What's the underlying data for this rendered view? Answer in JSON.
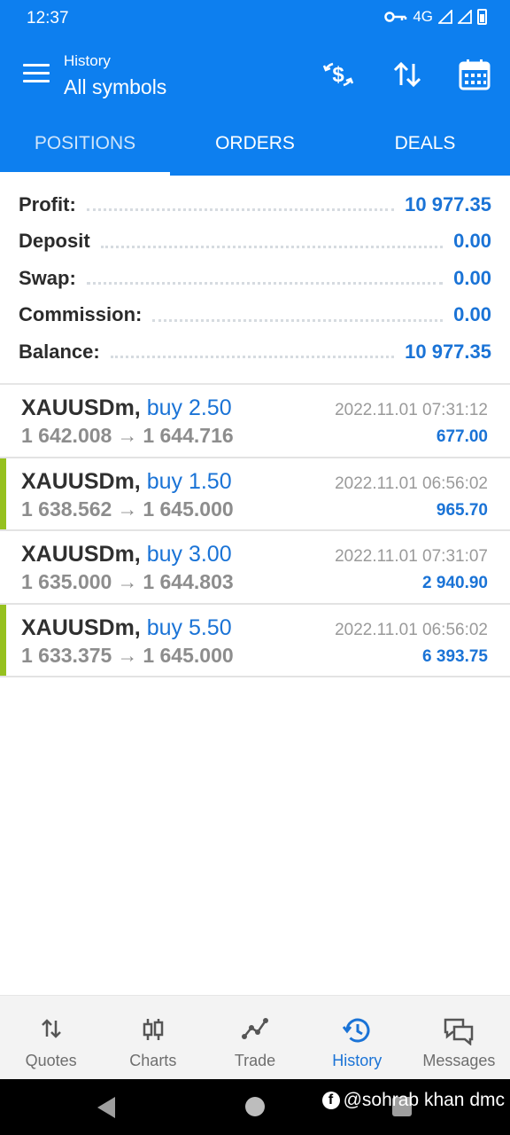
{
  "status_bar": {
    "time": "12:37",
    "network": "4G"
  },
  "app_bar": {
    "subtitle": "History",
    "title": "All symbols"
  },
  "tabs": [
    {
      "label": "POSITIONS",
      "active": true
    },
    {
      "label": "ORDERS",
      "active": false
    },
    {
      "label": "DEALS",
      "active": false
    }
  ],
  "summary": [
    {
      "label": "Profit:",
      "value": "10 977.35"
    },
    {
      "label": "Deposit",
      "value": "0.00"
    },
    {
      "label": "Swap:",
      "value": "0.00"
    },
    {
      "label": "Commission:",
      "value": "0.00"
    },
    {
      "label": "Balance:",
      "value": "10 977.35"
    }
  ],
  "deals": [
    {
      "symbol": "XAUUSDm,",
      "direction": "buy 2.50",
      "open_price": "1 642.008",
      "close_price": "1 644.716",
      "arrow": "→",
      "time": "2022.11.01 07:31:12",
      "profit": "677.00",
      "marked": false
    },
    {
      "symbol": "XAUUSDm,",
      "direction": "buy 1.50",
      "open_price": "1 638.562",
      "close_price": "1 645.000",
      "arrow": "→",
      "time": "2022.11.01 06:56:02",
      "profit": "965.70",
      "marked": true
    },
    {
      "symbol": "XAUUSDm,",
      "direction": "buy 3.00",
      "open_price": "1 635.000",
      "close_price": "1 644.803",
      "arrow": "→",
      "time": "2022.11.01 07:31:07",
      "profit": "2 940.90",
      "marked": false
    },
    {
      "symbol": "XAUUSDm,",
      "direction": "buy 5.50",
      "open_price": "1 633.375",
      "close_price": "1 645.000",
      "arrow": "→",
      "time": "2022.11.01 06:56:02",
      "profit": "6 393.75",
      "marked": true
    }
  ],
  "bottom_nav": [
    {
      "label": "Quotes",
      "icon": "quotes-arrows-icon",
      "active": false
    },
    {
      "label": "Charts",
      "icon": "candlestick-icon",
      "active": false
    },
    {
      "label": "Trade",
      "icon": "trade-line-icon",
      "active": false
    },
    {
      "label": "History",
      "icon": "history-clock-icon",
      "active": true
    },
    {
      "label": "Messages",
      "icon": "messages-icon",
      "active": false
    }
  ],
  "watermark": {
    "text": "@sohrab khan dmc"
  },
  "colors": {
    "primary": "#0d7fef",
    "accent_text": "#1a73d6",
    "marker": "#96c11f"
  }
}
